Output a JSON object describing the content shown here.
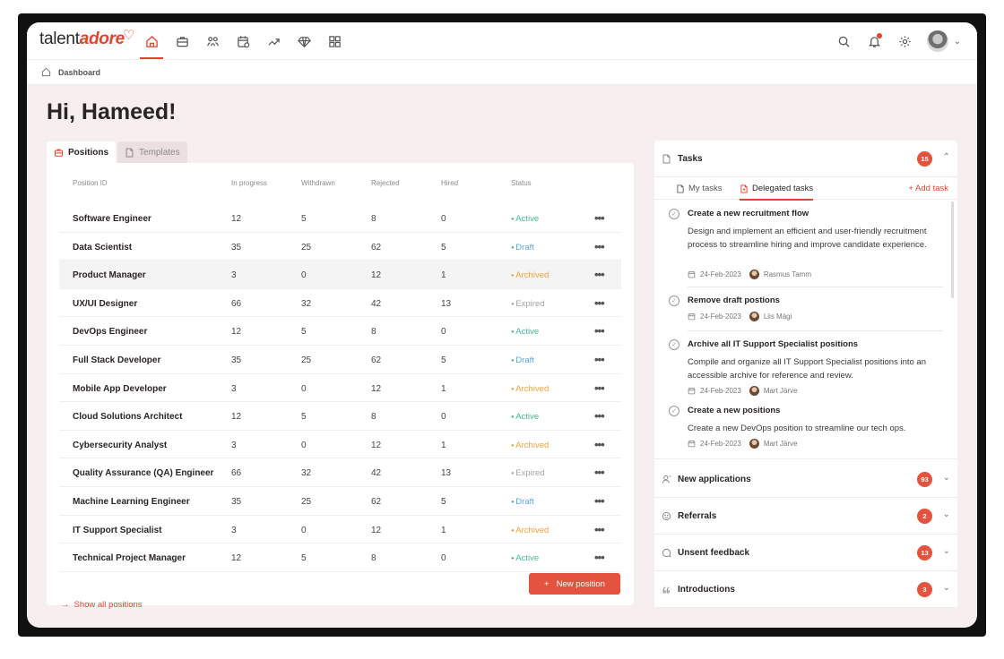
{
  "brand": {
    "prefix": "talent",
    "suffix": "adore"
  },
  "nav": {
    "icons": [
      "home-icon",
      "briefcase-icon",
      "people-icon",
      "calendar-icon",
      "trend-icon",
      "diamond-icon",
      "grid-icon"
    ],
    "right_icons": [
      "search-icon",
      "bell-icon",
      "gear-icon"
    ]
  },
  "breadcrumb": {
    "label": "Dashboard"
  },
  "greeting": "Hi, Hameed!",
  "tabs": {
    "positions": "Positions",
    "templates": "Templates"
  },
  "table": {
    "headers": [
      "Position ID",
      "In progress",
      "Withdrawn",
      "Rejected",
      "Hired",
      "Status"
    ],
    "rows": [
      {
        "name": "Software Engineer",
        "in_progress": "12",
        "withdrawn": "5",
        "rejected": "8",
        "hired": "0",
        "status": "Active"
      },
      {
        "name": "Data Scientist",
        "in_progress": "35",
        "withdrawn": "25",
        "rejected": "62",
        "hired": "5",
        "status": "Draft"
      },
      {
        "name": "Product Manager",
        "in_progress": "3",
        "withdrawn": "0",
        "rejected": "12",
        "hired": "1",
        "status": "Archived"
      },
      {
        "name": "UX/UI Designer",
        "in_progress": "66",
        "withdrawn": "32",
        "rejected": "42",
        "hired": "13",
        "status": "Expired"
      },
      {
        "name": "DevOps Engineer",
        "in_progress": "12",
        "withdrawn": "5",
        "rejected": "8",
        "hired": "0",
        "status": "Active"
      },
      {
        "name": "Full Stack Developer",
        "in_progress": "35",
        "withdrawn": "25",
        "rejected": "62",
        "hired": "5",
        "status": "Draft"
      },
      {
        "name": "Mobile App Developer",
        "in_progress": "3",
        "withdrawn": "0",
        "rejected": "12",
        "hired": "1",
        "status": "Archived"
      },
      {
        "name": "Cloud Solutions Architect",
        "in_progress": "12",
        "withdrawn": "5",
        "rejected": "8",
        "hired": "0",
        "status": "Active"
      },
      {
        "name": "Cybersecurity Analyst",
        "in_progress": "3",
        "withdrawn": "0",
        "rejected": "12",
        "hired": "1",
        "status": "Archived"
      },
      {
        "name": "Quality Assurance (QA) Engineer",
        "in_progress": "66",
        "withdrawn": "32",
        "rejected": "42",
        "hired": "13",
        "status": "Expired"
      },
      {
        "name": "Machine Learning Engineer",
        "in_progress": "35",
        "withdrawn": "25",
        "rejected": "62",
        "hired": "5",
        "status": "Draft"
      },
      {
        "name": "IT Support Specialist",
        "in_progress": "3",
        "withdrawn": "0",
        "rejected": "12",
        "hired": "1",
        "status": "Archived"
      },
      {
        "name": "Technical Project Manager",
        "in_progress": "12",
        "withdrawn": "5",
        "rejected": "8",
        "hired": "0",
        "status": "Active"
      }
    ],
    "row_menu": "•••"
  },
  "actions": {
    "show_all": "Show all positions",
    "new_position": "New position"
  },
  "tasks": {
    "title": "Tasks",
    "count": "15",
    "my_tasks": "My tasks",
    "delegated": "Delegated tasks",
    "add_task": "+ Add task",
    "items": [
      {
        "title": "Create a new recruitment flow",
        "desc": "Design and implement an efficient and user-friendly recruitment process to streamline hiring and improve candidate experience.",
        "date": "24-Feb-2023",
        "person": "Rasmus Tamm"
      },
      {
        "title": "Remove draft postions",
        "desc": "",
        "date": "24-Feb-2023",
        "person": "Liis Mägi"
      },
      {
        "title": "Archive all IT Support Specialist positions",
        "desc": "Compile and organize all IT Support Specialist positions into an accessible archive for reference and review.",
        "date": "24-Feb-2023",
        "person": "Mart Järve"
      },
      {
        "title": "Create a new positions",
        "desc": "Create a new DevOps position to streamline our tech ops.",
        "date": "24-Feb-2023",
        "person": "Mart Järve"
      }
    ]
  },
  "sections": [
    {
      "label": "New applications",
      "count": "93",
      "icon": "person-icon"
    },
    {
      "label": "Referrals",
      "count": "2",
      "icon": "smile-icon"
    },
    {
      "label": "Unsent feedback",
      "count": "13",
      "icon": "chat-icon"
    },
    {
      "label": "Introductions",
      "count": "3",
      "icon": "quote-icon"
    }
  ],
  "colors": {
    "accent": "#e0452e",
    "active": "#45b89a",
    "draft": "#5aa6e0",
    "archived": "#f0a23a",
    "expired": "#a5a5a5"
  }
}
